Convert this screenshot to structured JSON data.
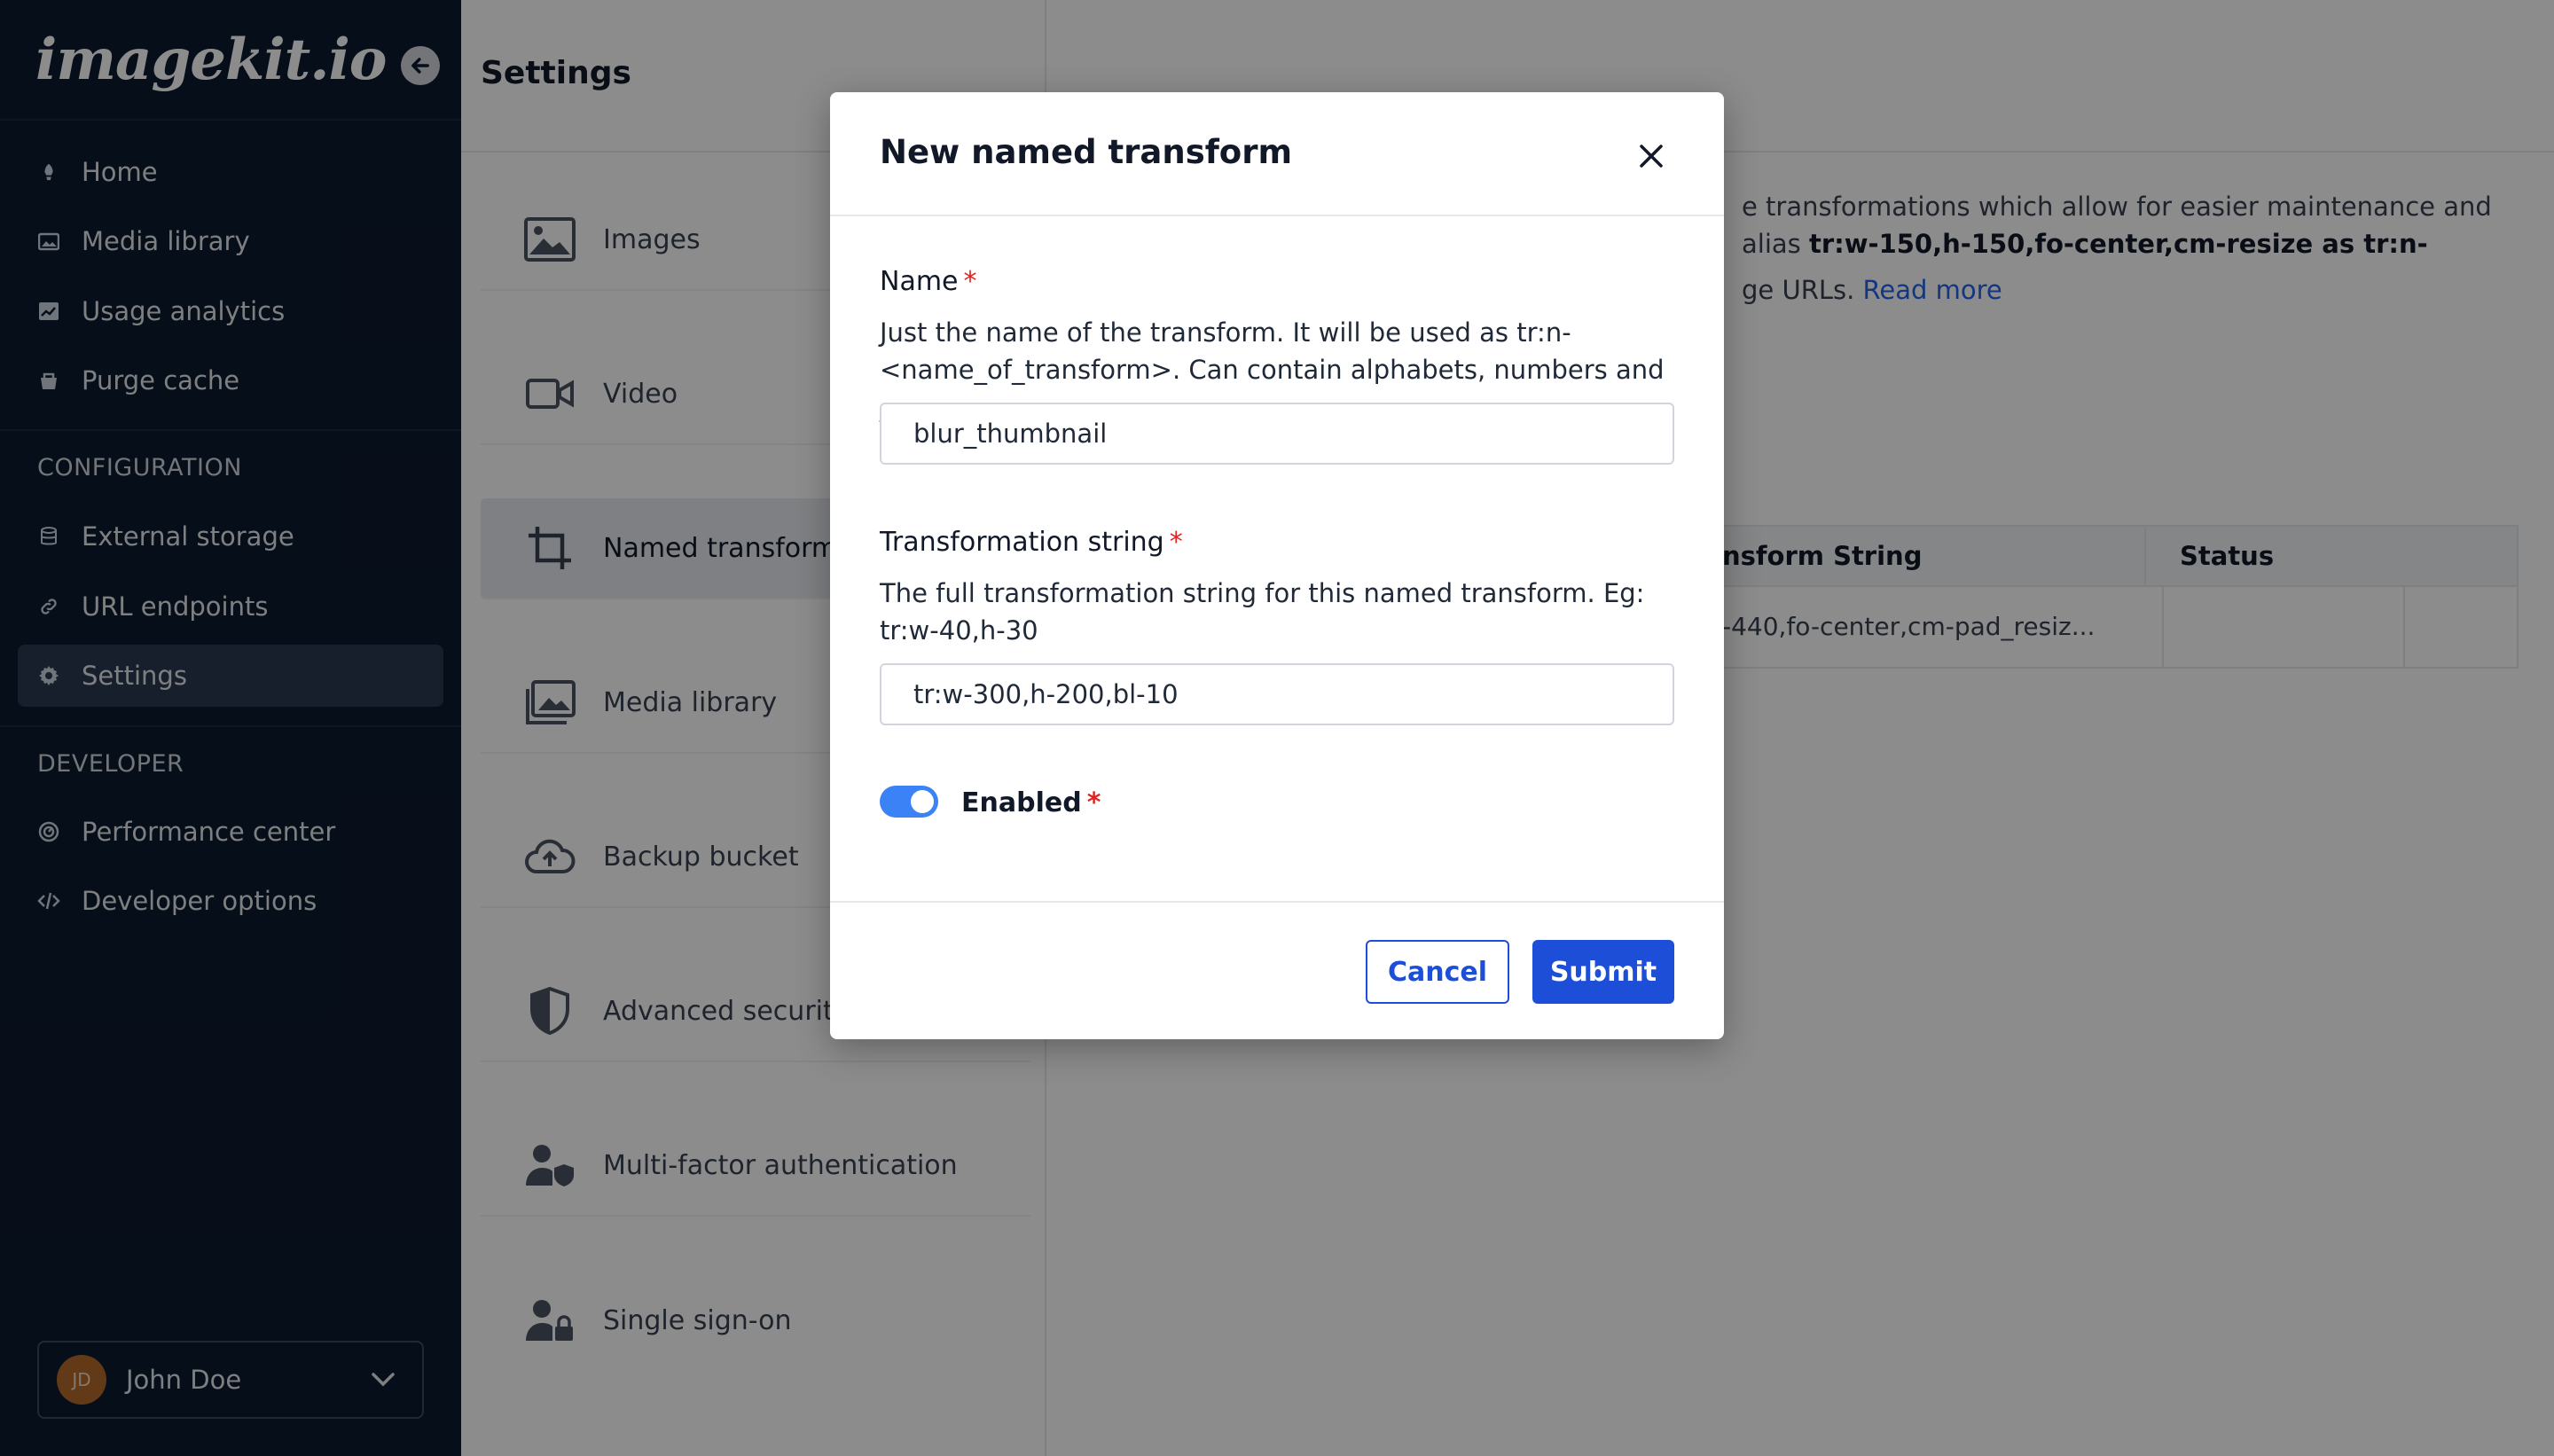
{
  "sidebar": {
    "logo": "imagekit.io",
    "nav": [
      {
        "label": "Home",
        "icon": "rocket-icon"
      },
      {
        "label": "Media library",
        "icon": "media-icon"
      },
      {
        "label": "Usage analytics",
        "icon": "analytics-icon"
      },
      {
        "label": "Purge cache",
        "icon": "cache-icon"
      }
    ],
    "configuration_title": "CONFIGURATION",
    "configuration": [
      {
        "label": "External storage",
        "icon": "database-icon"
      },
      {
        "label": "URL endpoints",
        "icon": "link-icon"
      },
      {
        "label": "Settings",
        "icon": "gear-icon"
      }
    ],
    "developer_title": "DEVELOPER",
    "developer": [
      {
        "label": "Performance center",
        "icon": "gauge-icon"
      },
      {
        "label": "Developer options",
        "icon": "code-icon"
      }
    ],
    "user": {
      "initials": "JD",
      "name": "John Doe"
    }
  },
  "settings_panel": {
    "title": "Settings",
    "items": [
      {
        "label": "Images",
        "icon": "image-icon"
      },
      {
        "label": "Video",
        "icon": "video-icon"
      },
      {
        "label": "Named transforms",
        "icon": "crop-icon"
      },
      {
        "label": "Media library",
        "icon": "media-library-icon"
      },
      {
        "label": "Backup bucket",
        "icon": "cloud-upload-icon"
      },
      {
        "label": "Advanced security",
        "icon": "shield-icon"
      },
      {
        "label": "Multi-factor authentication",
        "icon": "user-shield-icon"
      },
      {
        "label": "Single sign-on",
        "icon": "user-lock-icon"
      }
    ]
  },
  "main": {
    "desc_line1": "e transformations which allow for easier maintenance and",
    "desc_line2_prefix": "alias ",
    "desc_line2_bold": "tr:w-150,h-150,fo-center,cm-resize as tr:n-",
    "desc_line3_prefix": "ge URLs. ",
    "read_more": "Read more",
    "table": {
      "col_transform": "nsform String",
      "col_status": "Status",
      "row_transform": "-440,fo-center,cm-pad_resiz..."
    }
  },
  "modal": {
    "title": "New named transform",
    "name_label": "Name",
    "name_help": "Just the name of the transform. It will be used as tr:n-<name_of_transform>. Can contain alphabets, numbers and _",
    "name_value": "blur_thumbnail",
    "transform_label": "Transformation string",
    "transform_help": "The full transformation string for this named transform. Eg: tr:w-40,h-30",
    "transform_value": "tr:w-300,h-200,bl-10",
    "enabled_label": "Enabled",
    "required_mark": "*",
    "cancel": "Cancel",
    "submit": "Submit"
  },
  "colors": {
    "sidebar_bg": "#0c1a2f",
    "primary": "#1d4ed8",
    "toggle_on": "#3b82f6",
    "required": "#dc2626",
    "link": "#2563eb"
  }
}
